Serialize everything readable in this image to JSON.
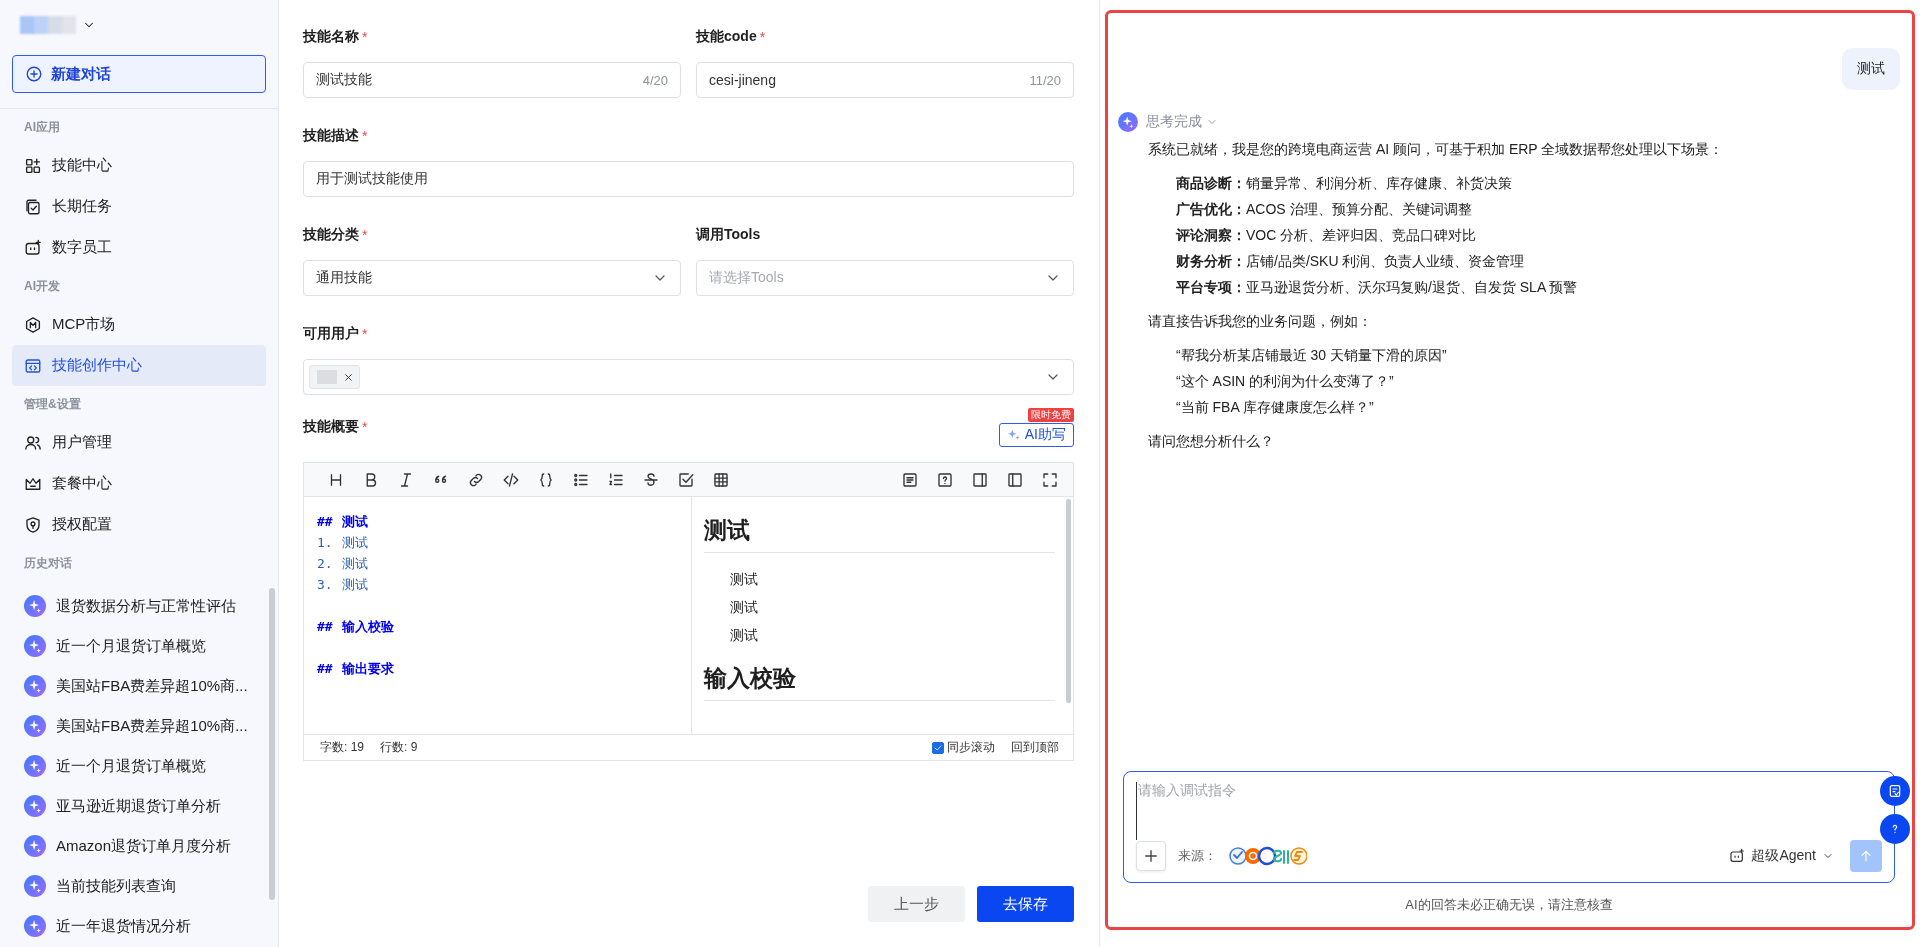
{
  "sidebar": {
    "new_chat_button": "新建对话",
    "sections": [
      {
        "title": "AI应用",
        "items": [
          {
            "label": "技能中心",
            "selected": false
          },
          {
            "label": "长期任务",
            "selected": false
          },
          {
            "label": "数字员工",
            "selected": false
          }
        ]
      },
      {
        "title": "AI开发",
        "items": [
          {
            "label": "MCP市场",
            "selected": false
          },
          {
            "label": "技能创作中心",
            "selected": true
          }
        ]
      },
      {
        "title": "管理&设置",
        "items": [
          {
            "label": "用户管理",
            "selected": false
          },
          {
            "label": "套餐中心",
            "selected": false
          },
          {
            "label": "授权配置",
            "selected": false
          }
        ]
      }
    ],
    "history": {
      "title": "历史对话",
      "items": [
        "退货数据分析与正常性评估",
        "近一个月退货订单概览",
        "美国站FBA费差异超10%商...",
        "美国站FBA费差异超10%商...",
        "近一个月退货订单概览",
        "亚马逊近期退货订单分析",
        "Amazon退货订单月度分析",
        "当前技能列表查询",
        "近一年退货情况分析"
      ]
    }
  },
  "form": {
    "rows": [
      [
        {
          "kind": "text",
          "label": "技能名称",
          "required_mark": "*",
          "value": "测试技能",
          "counter": "4/20"
        },
        {
          "kind": "text",
          "label": "技能code",
          "required_mark": "*",
          "value": "cesi-jineng",
          "counter": "11/20"
        }
      ],
      [
        {
          "kind": "text",
          "label": "技能描述",
          "required_mark": "*",
          "value": "用于测试技能使用"
        }
      ],
      [
        {
          "kind": "select",
          "label": "技能分类",
          "required_mark": "*",
          "value": "通用技能"
        },
        {
          "kind": "select",
          "label": "调用Tools",
          "placeholder": "请选择Tools"
        }
      ],
      [
        {
          "kind": "tags",
          "label": "可用用户",
          "required_mark": "*",
          "tags": [
            {
              "kind": "redacted"
            }
          ]
        }
      ]
    ],
    "overview": {
      "label": "技能概要",
      "required_mark": "*",
      "ai_button": "AI助写",
      "ai_badge": "限时免费"
    },
    "editor": {
      "source": [
        {
          "kind": "heading",
          "marker": "##",
          "text": "测试"
        },
        {
          "kind": "list",
          "marker": "1.",
          "text": "测试"
        },
        {
          "kind": "list",
          "marker": "2.",
          "text": "测试"
        },
        {
          "kind": "list",
          "marker": "3.",
          "text": "测试"
        },
        {
          "kind": "heading",
          "marker": "##",
          "text": "输入校验"
        },
        {
          "kind": "heading",
          "marker": "##",
          "text": "输出要求"
        }
      ],
      "preview": [
        {
          "kind": "heading",
          "text": "测试"
        },
        {
          "kind": "item",
          "text": "测试"
        },
        {
          "kind": "item",
          "text": "测试"
        },
        {
          "kind": "item",
          "text": "测试"
        },
        {
          "kind": "heading",
          "text": "输入校验"
        }
      ],
      "word_count": "字数: 19",
      "line_count": "行数: 9",
      "sync_scroll": {
        "label": "同步滚动",
        "checked": true
      },
      "back_to_top": "回到顶部"
    },
    "buttons": [
      {
        "label": "上一步",
        "kind": "secondary"
      },
      {
        "label": "去保存",
        "kind": "primary"
      }
    ]
  },
  "chat": {
    "user_message": "测试",
    "status": "思考完成",
    "intro": "系统已就绪，我是您的跨境电商运营 AI 顾问，可基于积加 ERP 全域数据帮您处理以下场景：",
    "scenarios": [
      "**商品诊断：**销量异常、利润分析、库存健康、补货决策",
      "**广告优化：**ACOS 治理、预算分配、关键词调整",
      "**评论洞察：**VOC 分析、差评归因、竞品口碑对比",
      "**财务分析：**店铺/品类/SKU 利润、负责人业绩、资金管理",
      "**平台专项：**亚马逊退货分析、沃尔玛复购/退货、自发货 SLA 预警"
    ],
    "prompt": "请直接告诉我您的业务问题，例如：",
    "examples": [
      "“帮我分析某店铺最近 30 天销量下滑的原因”",
      "“这个 ASIN 的利润为什么变薄了？”",
      "“当前 FBA 库存健康度怎么样？”"
    ],
    "closing": "请问您想分析什么？",
    "input": {
      "placeholder": "请输入调试指令",
      "source_label": "来源：",
      "mode": "超级Agent"
    },
    "disclaimer": "AI的回答未必正确无误，请注意核查"
  }
}
